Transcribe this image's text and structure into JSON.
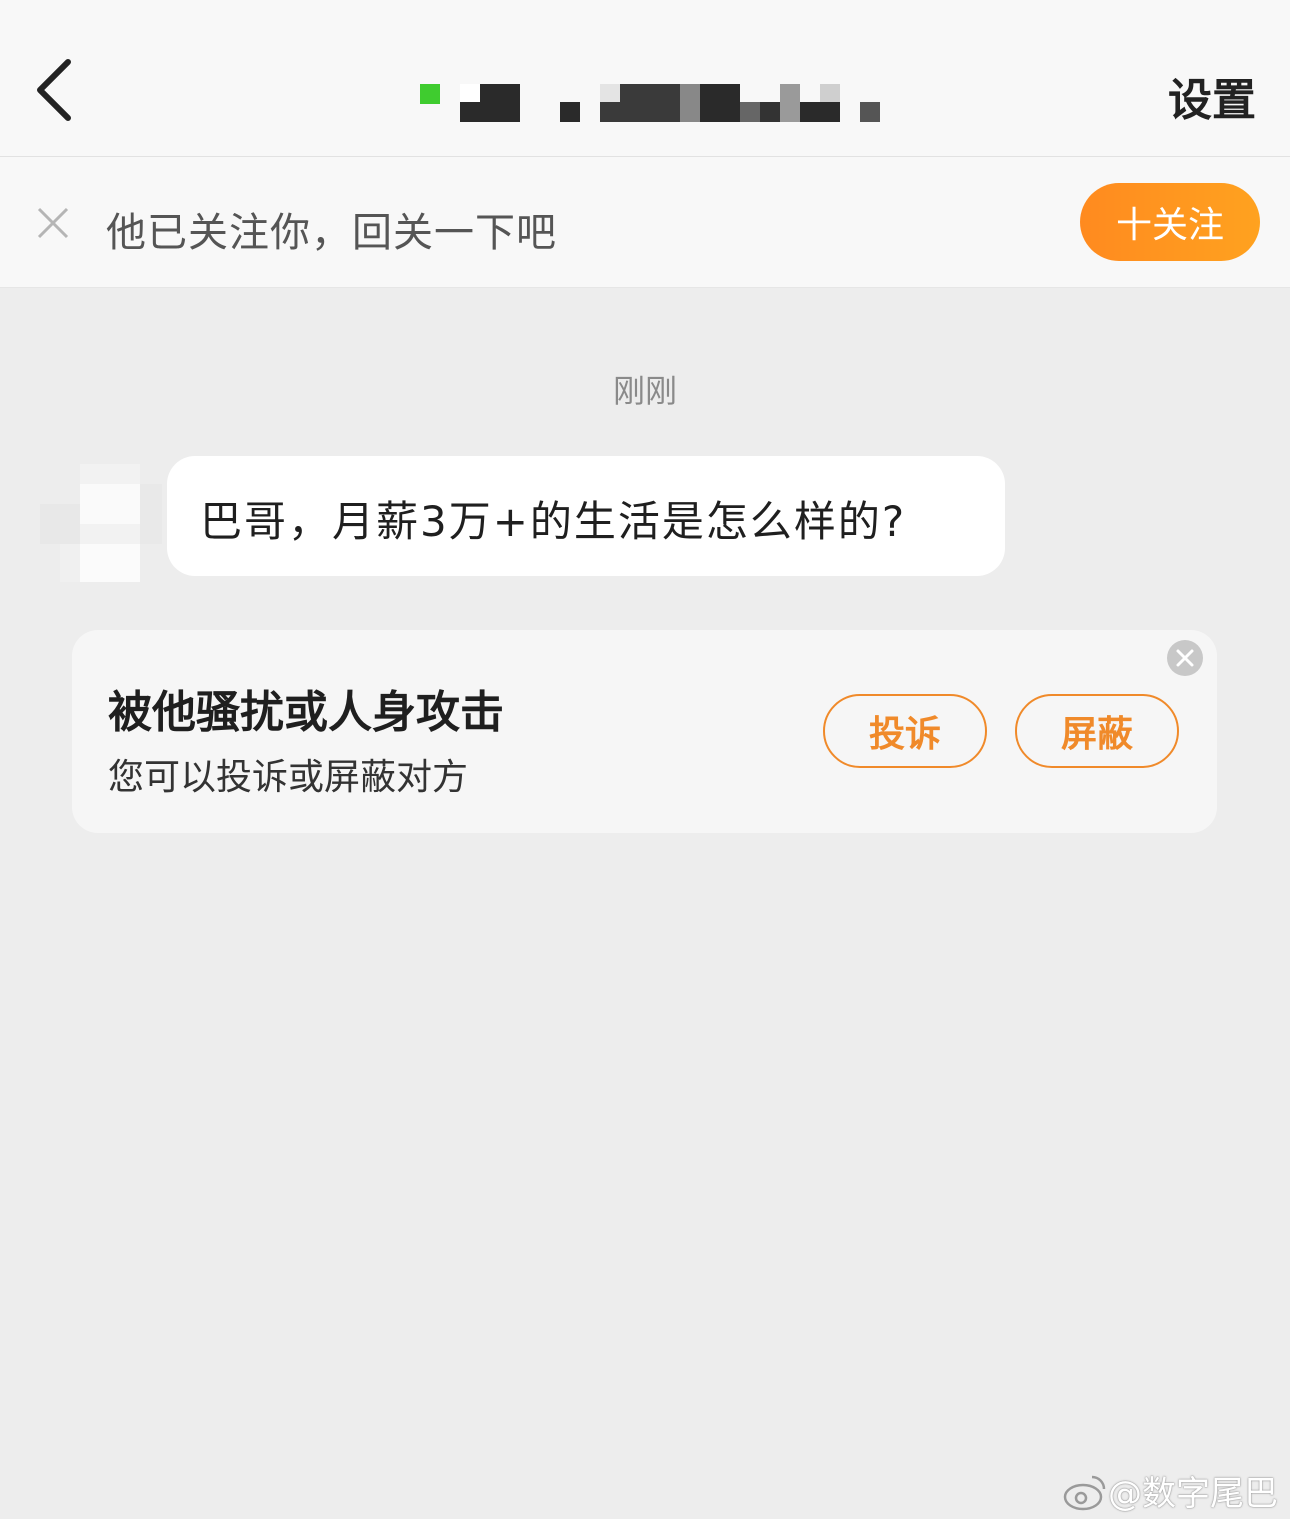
{
  "header": {
    "settings_label": "设置"
  },
  "follow_bar": {
    "message": "他已关注你，回关一下吧",
    "follow_button": "十关注"
  },
  "chat": {
    "timestamp": "刚刚",
    "message": "巴哥，月薪3万+的生活是怎么样的?"
  },
  "report_card": {
    "title": "被他骚扰或人身攻击",
    "subtitle": "您可以投诉或屏蔽对方",
    "report_button": "投诉",
    "block_button": "屏蔽"
  },
  "watermark": {
    "text": "@数字尾巴"
  },
  "colors": {
    "accent": "#ff9520",
    "online": "#3fcc2f"
  }
}
